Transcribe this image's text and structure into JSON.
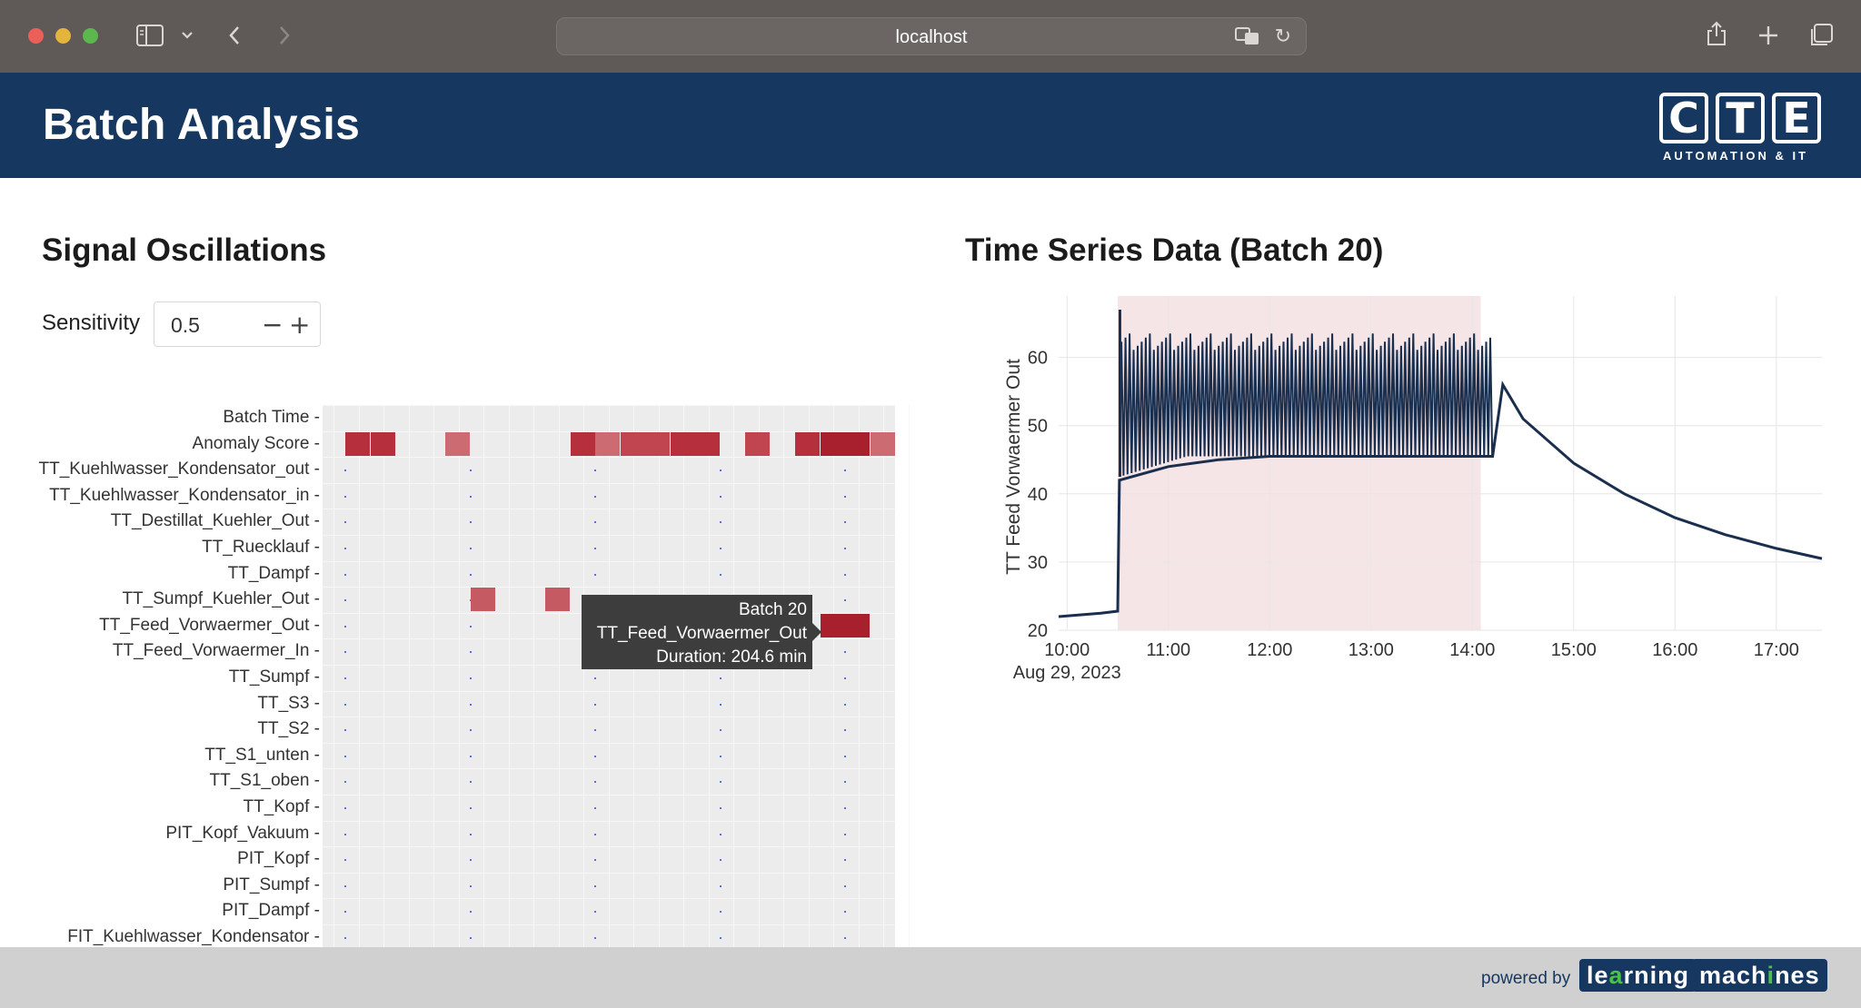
{
  "browser": {
    "url": "localhost"
  },
  "header": {
    "title": "Batch Analysis",
    "logo_letters": [
      "C",
      "T",
      "E"
    ],
    "logo_subtitle": "AUTOMATION & IT"
  },
  "oscillations": {
    "title": "Signal Oscillations",
    "sensitivity_label": "Sensitivity",
    "sensitivity_value": "0.5",
    "rows": [
      "Batch Time",
      "Anomaly Score",
      "TT_Kuehlwasser_Kondensator_out",
      "TT_Kuehlwasser_Kondensator_in",
      "TT_Destillat_Kuehler_Out",
      "TT_Ruecklauf",
      "TT_Dampf",
      "TT_Sumpf_Kuehler_Out",
      "TT_Feed_Vorwaermer_Out",
      "TT_Feed_Vorwaermer_In",
      "TT_Sumpf",
      "TT_S3",
      "TT_S2",
      "TT_S1_unten",
      "TT_S1_oben",
      "TT_Kopf",
      "PIT_Kopf_Vakuum",
      "PIT_Kopf",
      "PIT_Sumpf",
      "PIT_Dampf",
      "FIT_Kuehlwasser_Kondensator"
    ],
    "cells": [
      {
        "row": 1,
        "col": 1,
        "color": "#b5303c"
      },
      {
        "row": 1,
        "col": 2,
        "color": "#b5303c"
      },
      {
        "row": 1,
        "col": 5,
        "color": "#cd6b72"
      },
      {
        "row": 1,
        "col": 10,
        "color": "#b5303c"
      },
      {
        "row": 1,
        "col": 11,
        "color": "#cd6b72"
      },
      {
        "row": 1,
        "col": 12,
        "color": "#c04550"
      },
      {
        "row": 1,
        "col": 13,
        "color": "#c04550"
      },
      {
        "row": 1,
        "col": 14,
        "color": "#b5303c"
      },
      {
        "row": 1,
        "col": 15,
        "color": "#b5303c"
      },
      {
        "row": 1,
        "col": 17,
        "color": "#c04550"
      },
      {
        "row": 1,
        "col": 19,
        "color": "#b5303c"
      },
      {
        "row": 1,
        "col": 20,
        "color": "#a81f2d"
      },
      {
        "row": 1,
        "col": 21,
        "color": "#a81f2d"
      },
      {
        "row": 1,
        "col": 22,
        "color": "#cd6b72"
      },
      {
        "row": 7,
        "col": 6,
        "color": "#c65a63"
      },
      {
        "row": 7,
        "col": 9,
        "color": "#c65a63"
      },
      {
        "row": 8,
        "col": 20,
        "color": "#a81f2d"
      },
      {
        "row": 8,
        "col": 21,
        "color": "#a81f2d"
      }
    ],
    "tooltip": {
      "batch": "Batch 20",
      "signal": "TT_Feed_Vorwaermer_Out",
      "duration": "Duration: 204.6 min"
    }
  },
  "timeseries": {
    "title": "Time Series Data (Batch 20)",
    "chart_data": {
      "type": "line",
      "title": "Time Series Data (Batch 20)",
      "xlabel": "",
      "ylabel": "TT Feed Vorwaermer Out",
      "x_ticks": [
        "10:00",
        "11:00",
        "12:00",
        "13:00",
        "14:00",
        "15:00",
        "16:00",
        "17:00"
      ],
      "x_date_label": "Aug 29, 2023",
      "y_ticks": [
        20,
        30,
        40,
        50,
        60
      ],
      "ylim": [
        20,
        69
      ],
      "xlim": [
        "09:55",
        "17:27"
      ],
      "highlight_range": [
        "10:30",
        "14:05"
      ],
      "series": [
        {
          "color": "#1a2e4e",
          "points": [
            {
              "t": "09:55",
              "y": 22.0
            },
            {
              "t": "10:20",
              "y": 22.5
            },
            {
              "t": "10:30",
              "y": 22.8
            },
            {
              "t": "10:31",
              "y": 42.0
            },
            {
              "t": "11:00",
              "y": 44.0
            },
            {
              "t": "11:30",
              "y": 45.0
            },
            {
              "t": "12:00",
              "y": 45.5
            },
            {
              "t": "13:00",
              "y": 45.5
            },
            {
              "t": "14:00",
              "y": 45.5
            },
            {
              "t": "14:12",
              "y": 45.5
            },
            {
              "t": "14:18",
              "y": 56.0
            },
            {
              "t": "14:30",
              "y": 51.0
            },
            {
              "t": "15:00",
              "y": 44.5
            },
            {
              "t": "15:30",
              "y": 40.0
            },
            {
              "t": "16:00",
              "y": 36.5
            },
            {
              "t": "16:30",
              "y": 34.0
            },
            {
              "t": "17:00",
              "y": 32.0
            },
            {
              "t": "17:27",
              "y": 30.5
            }
          ],
          "oscillation_band": {
            "from": "10:31",
            "to": "14:12",
            "low": 42.5,
            "high": 63.5,
            "peak": 67
          }
        }
      ]
    }
  },
  "footer": {
    "powered_by": "powered by",
    "brand_part1_a": "le",
    "brand_part1_hl": "a",
    "brand_part1_b": "rning",
    "brand_part2_a": "mach",
    "brand_part2_hl": "i",
    "brand_part2_b": "nes"
  }
}
